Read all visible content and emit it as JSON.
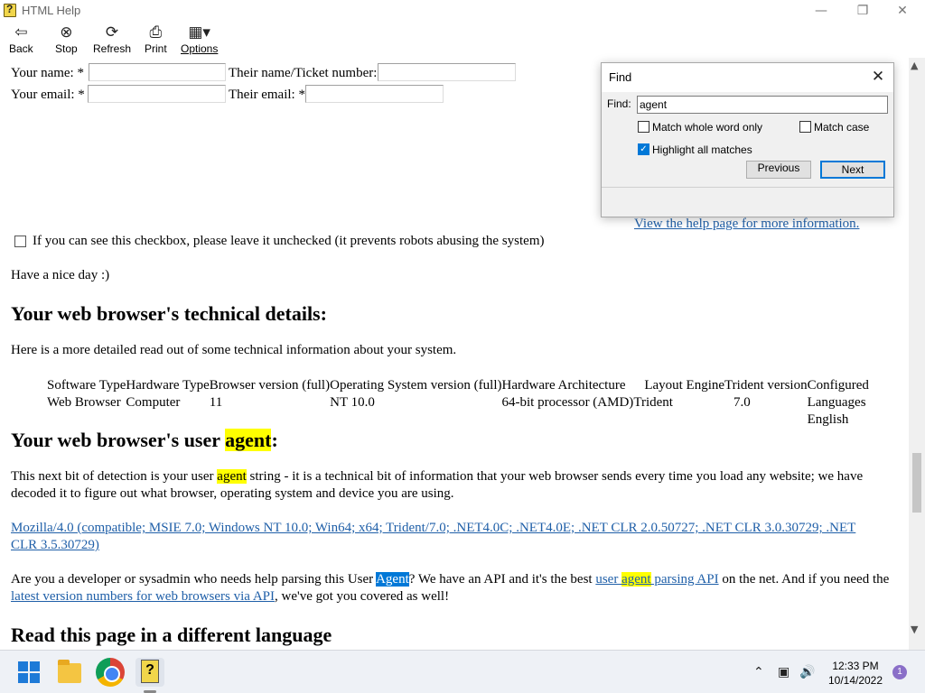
{
  "window": {
    "title": "HTML Help",
    "minimize_icon": "minimize-icon",
    "restore_icon": "restore-icon",
    "close_icon": "close-icon"
  },
  "toolbar": {
    "back": "Back",
    "stop": "Stop",
    "refresh": "Refresh",
    "print": "Print",
    "options": "Options"
  },
  "form": {
    "your_name": "Your name: *",
    "their_name": "Their name/Ticket number:",
    "your_email": "Your email: *",
    "their_email": "Their email: *",
    "robot_checkbox": "If you can see this checkbox, please leave it unchecked (it prevents robots abusing the system)",
    "nice_day": "Have a nice day :)",
    "help_link": "View the help page for more information."
  },
  "tech": {
    "heading": "Your web browser's technical details:",
    "intro": "Here is a more detailed read out of some technical information about your system.",
    "headers": [
      "Software Type",
      "Hardware Type",
      "Browser version (full)",
      "Operating System version (full)",
      "Hardware Architecture",
      "Layout Engine",
      "Trident version",
      "Configured"
    ],
    "row": [
      "Web Browser",
      "Computer",
      "11",
      "NT 10.0",
      "64-bit processor (AMD)",
      "Trident",
      "7.0",
      "Languages"
    ],
    "row2_last": "English"
  },
  "ua": {
    "heading_pre": "Your web browser's user ",
    "heading_hl": "agent",
    "heading_post": ":",
    "para1_pre": "This next bit of detection is your user ",
    "para1_hl": "agent",
    "para1_post": " string - it is a technical bit of information that your web browser sends every time you load any website; we have",
    "para1_line2": "decoded it to figure out what browser, operating system and device you are using.",
    "ua_line1": "Mozilla/4.0 (compatible; MSIE 7.0; Windows NT 10.0; Win64; x64; Trident/7.0; .NET4.0C; .NET4.0E; .NET CLR 2.0.50727; .NET CLR 3.0.30729; .NET",
    "ua_line2": "CLR 3.5.30729)",
    "para2_a": "Are you a developer or sysadmin who needs help parsing this User ",
    "para2_cur": "Agent",
    "para2_b": "? We have an API and it's the best ",
    "para2_link_a": "user ",
    "para2_link_hl": "agent",
    "para2_link_b": " parsing API",
    "para2_c": " on the net. And if you need the",
    "para2_link2": "latest version numbers for web browsers via API",
    "para2_d": ", we've got you covered as well!"
  },
  "language": {
    "heading": "Read this page in a different language"
  },
  "find_dialog": {
    "title": "Find",
    "find_label": "Find:",
    "find_value": "agent",
    "match_whole_word": "Match whole word only",
    "match_case": "Match case",
    "highlight_all": "Highlight all matches",
    "highlight_all_checked": true,
    "previous": "Previous",
    "next": "Next"
  },
  "taskbar": {
    "time": "12:33 PM",
    "date": "10/14/2022",
    "notification_count": "1"
  },
  "colors": {
    "highlight": "#ffff00",
    "current_match": "#0078d7",
    "link": "#1f5fa8"
  }
}
